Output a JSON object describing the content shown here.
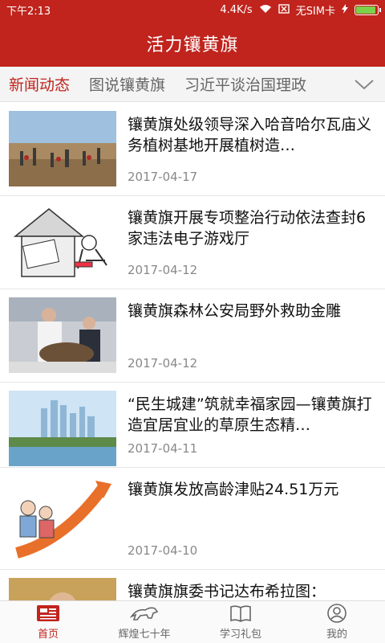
{
  "status": {
    "time": "下午2:13",
    "speed": "4.4K/s",
    "sim": "无SIM卡"
  },
  "app": {
    "title": "活力镶黄旗"
  },
  "tabs": [
    {
      "label": "新闻动态"
    },
    {
      "label": "图说镶黄旗"
    },
    {
      "label": "习近平谈治国理政"
    }
  ],
  "news": [
    {
      "title": "镶黄旗处级领导深入哈音哈尔瓦庙义务植树基地开展植树造…",
      "date": "2017-04-17"
    },
    {
      "title": "镶黄旗开展专项整治行动依法查封6家违法电子游戏厅",
      "date": "2017-04-12"
    },
    {
      "title": "镶黄旗森林公安局野外救助金雕",
      "date": "2017-04-12"
    },
    {
      "title": "“民生城建”筑就幸福家园—镶黄旗打造宜居宜业的草原生态精…",
      "date": "2017-04-11"
    },
    {
      "title": "镶黄旗发放高龄津贴24.51万元",
      "date": "2017-04-10"
    },
    {
      "title": "镶黄旗旗委书记达布希拉图：",
      "date": ""
    }
  ],
  "bottom_nav": [
    {
      "label": "首页",
      "icon": "newspaper-icon"
    },
    {
      "label": "辉煌七十年",
      "icon": "horse-icon"
    },
    {
      "label": "学习礼包",
      "icon": "book-icon"
    },
    {
      "label": "我的",
      "icon": "user-icon"
    }
  ],
  "colors": {
    "brand": "#c0241d",
    "active": "#c0241d",
    "battery": "#79d24a"
  }
}
